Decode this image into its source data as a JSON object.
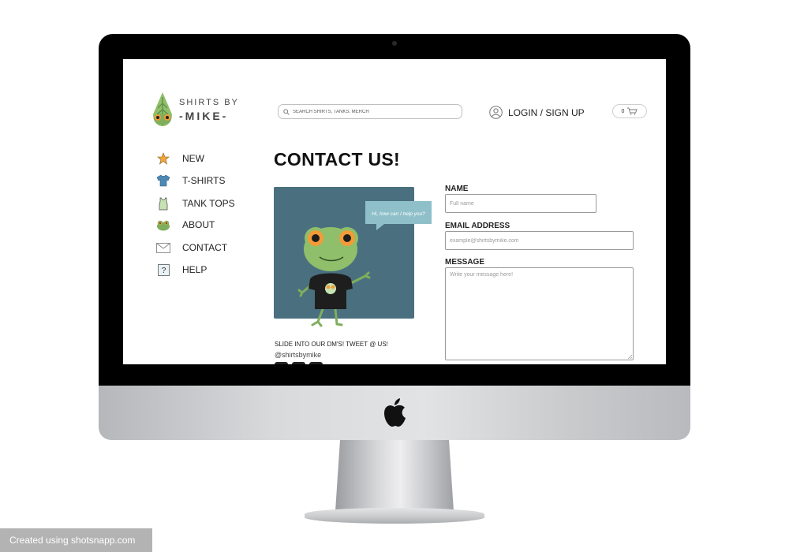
{
  "site": {
    "brand": {
      "top": "SHIRTS BY",
      "bottom": "-MIKE-"
    },
    "search": {
      "placeholder": "SEARCH SHIRTS, TANKS, MERCH"
    },
    "account": {
      "label": "LOGIN / SIGN UP"
    },
    "cart": {
      "count": "0"
    },
    "nav": [
      {
        "label": "NEW",
        "icon": "star-icon"
      },
      {
        "label": "T-SHIRTS",
        "icon": "tshirt-icon"
      },
      {
        "label": "TANK TOPS",
        "icon": "tank-top-icon"
      },
      {
        "label": "ABOUT",
        "icon": "frog-icon"
      },
      {
        "label": "CONTACT",
        "icon": "envelope-icon"
      },
      {
        "label": "HELP",
        "icon": "question-icon"
      }
    ],
    "page_title": "CONTACT US!",
    "speech_bubble": "Hi, how can I help you?",
    "social": {
      "heading": "SLIDE INTO OUR DM'S! TWEET @ US!",
      "handle": "@shirtsbymike"
    },
    "form": {
      "name_label": "NAME",
      "name_placeholder": "Full name",
      "email_label": "EMAIL ADDRESS",
      "email_placeholder": "example@shirtsbymike.com",
      "message_label": "MESSAGE",
      "message_placeholder": "Write your message here!"
    }
  },
  "colors": {
    "accent_teal": "#4a7080",
    "frog_green": "#8fbf6a",
    "bubble": "#8fc0ca",
    "star": "#f0a73c"
  },
  "watermark": "Created using shotsnapp.com"
}
